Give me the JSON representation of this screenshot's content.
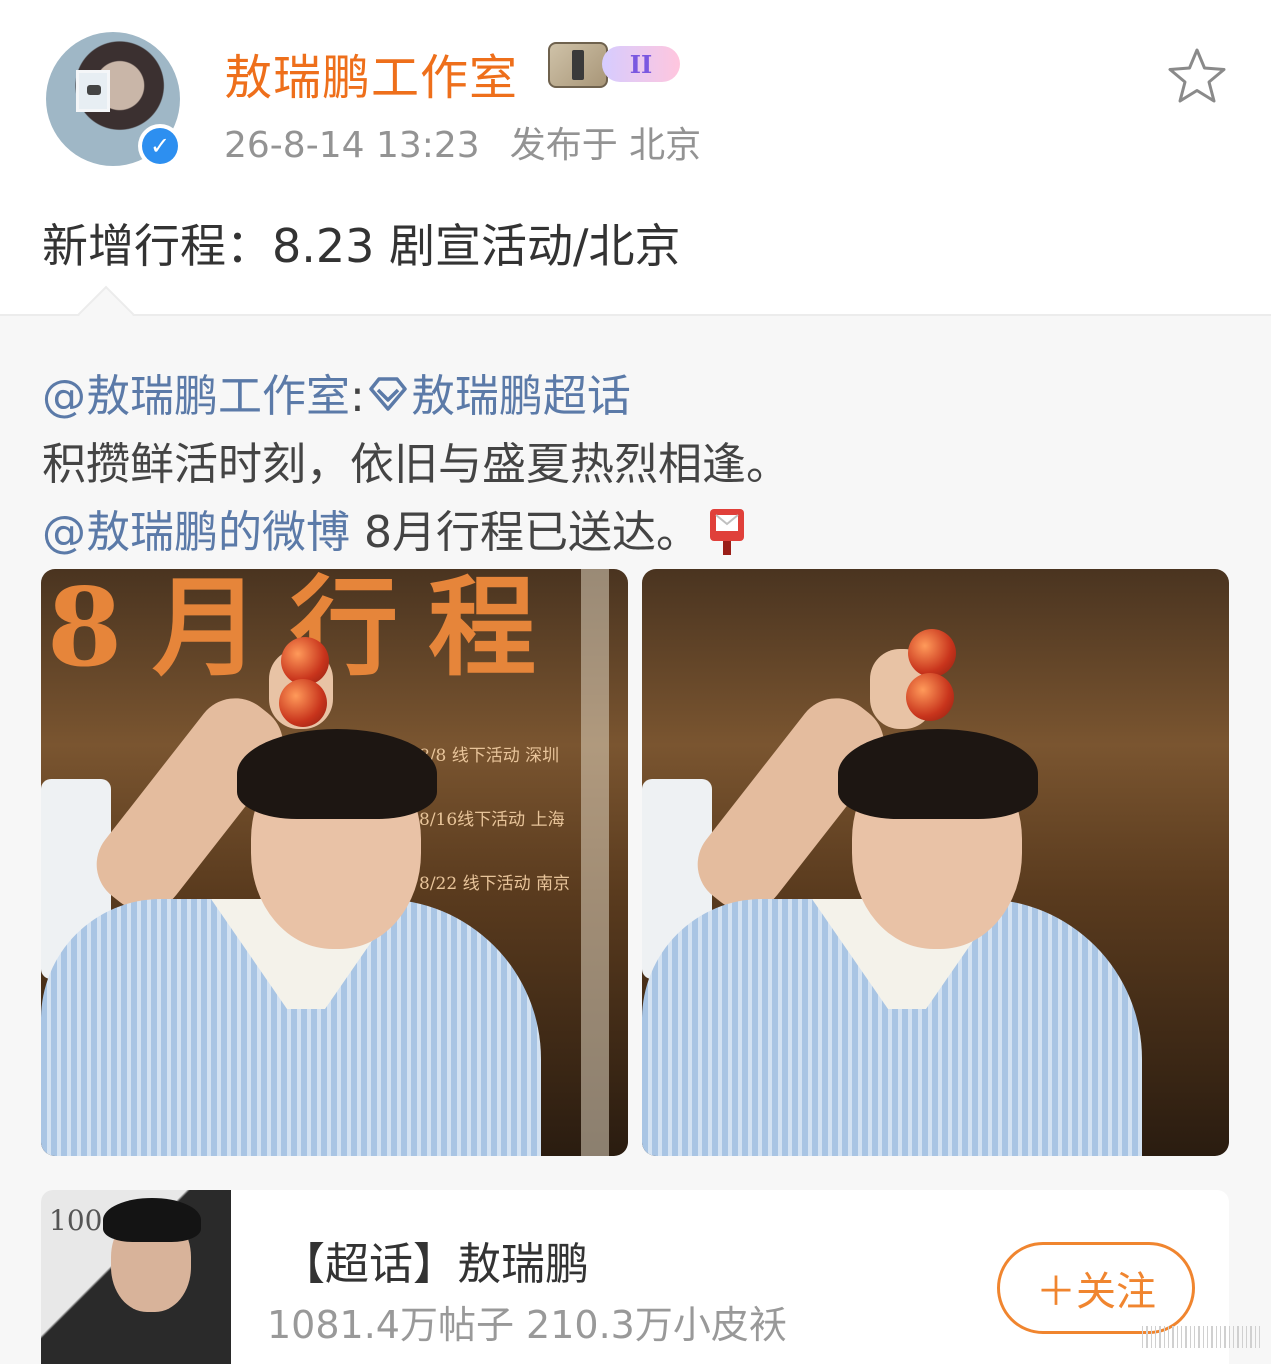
{
  "author": {
    "name": "敖瑞鹏工作室",
    "badge_level": "II",
    "timestamp": "26-8-14 13:23",
    "location": "发布于 北京"
  },
  "post": {
    "text": "新增行程：8.23 剧宣活动/北京"
  },
  "repost": {
    "mention": "@敖瑞鹏工作室",
    "separator": ":",
    "topic_link": "敖瑞鹏超话",
    "line2": "积攒鲜活时刻，依旧与盛夏热烈相逢。",
    "mention2": "@敖瑞鹏的微博",
    "line3": " 8月行程已送达。"
  },
  "images": [
    {
      "poster_title": "8月行程",
      "schedule": [
        "8/8 线下活动   深圳",
        "8/16线下活动   上海",
        "8/22 线下活动   南京"
      ]
    },
    {}
  ],
  "topic_card": {
    "title": "【超话】敖瑞鹏",
    "stats": "1081.4万帖子 210.3万小皮袄",
    "follow_label": "＋关注",
    "thumb_text": "1006"
  },
  "colors": {
    "username": "#ee6f1b",
    "link": "#5b7aa8",
    "follow": "#f0852f",
    "verified": "#2d8ff0"
  },
  "icons": [
    "verified-icon",
    "member-badge-icon",
    "star-icon",
    "diamond-topic-icon",
    "mailbox-icon"
  ]
}
